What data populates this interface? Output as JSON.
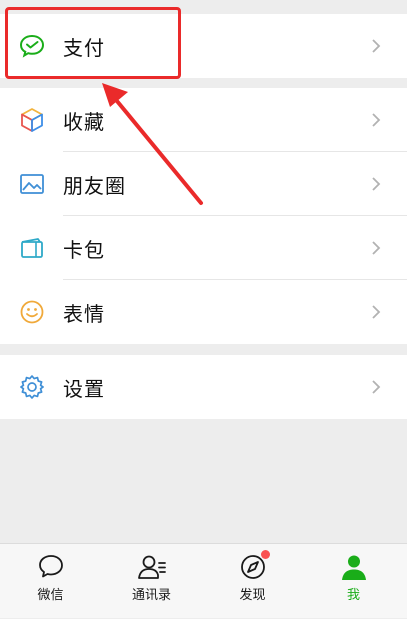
{
  "groups": {
    "pay": {
      "label": "支付"
    },
    "collections": {
      "label": "收藏"
    },
    "moments": {
      "label": "朋友圈"
    },
    "cards": {
      "label": "卡包"
    },
    "stickers": {
      "label": "表情"
    },
    "settings": {
      "label": "设置"
    }
  },
  "tabbar": {
    "chats": "微信",
    "contacts": "通讯录",
    "discover": "发现",
    "me": "我"
  },
  "colors": {
    "accent_green": "#1aad19",
    "highlight_red": "#ea2a2a",
    "badge_red": "#fa5151",
    "background": "#ededed"
  },
  "icons": [
    "wechat-pay-icon",
    "cube-icon",
    "picture-icon",
    "card-icon",
    "smiley-icon",
    "gear-icon",
    "chat-bubble-icon",
    "contacts-icon",
    "compass-icon",
    "person-icon",
    "chevron-right-icon"
  ]
}
